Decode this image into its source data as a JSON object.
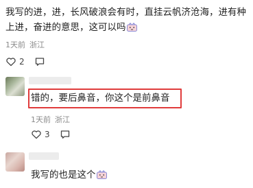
{
  "comment": {
    "text": "我写的进，进，长风破浪会有时，直挂云帆济沧海，进有种上进，奋进的意思，这可以吗",
    "time": "1天前",
    "location": "浙江",
    "likes": "2",
    "emoji": "shy-face-emoji"
  },
  "reply_1": {
    "text": "错的，要后鼻音，你这个是前鼻音",
    "time": "1天前",
    "location": "浙江",
    "likes": "3"
  },
  "reply_2": {
    "text": "我写的也是这个",
    "emoji": "shy-face-emoji"
  },
  "colors": {
    "highlight": "#e03b3b",
    "meta": "#8a8a8a"
  }
}
